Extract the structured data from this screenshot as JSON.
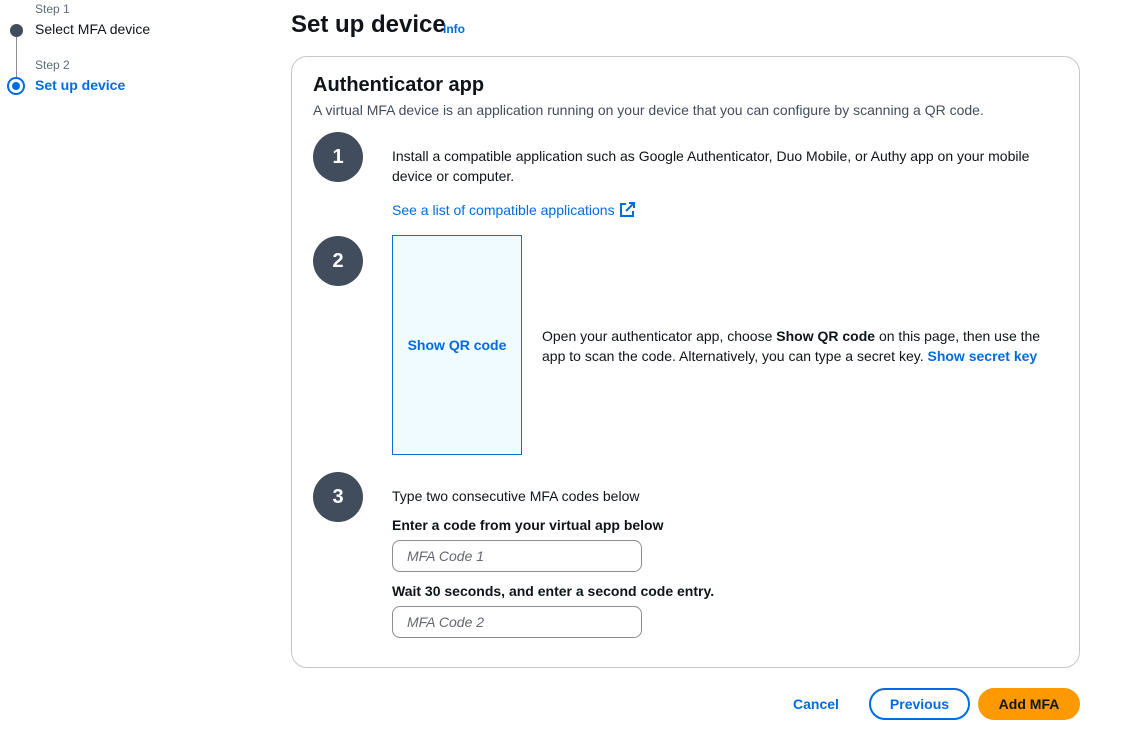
{
  "stepper": {
    "steps": [
      {
        "small": "Step 1",
        "name": "Select MFA device",
        "state": "completed"
      },
      {
        "small": "Step 2",
        "name": "Set up device",
        "state": "active"
      }
    ]
  },
  "header": {
    "title": "Set up device",
    "info": "Info"
  },
  "card": {
    "title": "Authenticator app",
    "description": "A virtual MFA device is an application running on your device that you can configure by scanning a QR code.",
    "step1": {
      "number": "1",
      "text": "Install a compatible application such as Google Authenticator, Duo Mobile, or Authy app on your mobile device or computer.",
      "link": "See a list of compatible applications"
    },
    "step2": {
      "number": "2",
      "qr_button": "Show QR code",
      "text_before": "Open your authenticator app, choose ",
      "text_bold": "Show QR code",
      "text_after": " on this page, then use the app to scan the code. Alternatively, you can type a secret key. ",
      "secret_link": "Show secret key"
    },
    "step3": {
      "number": "3",
      "intro": "Type two consecutive MFA codes below",
      "code1_label": "Enter a code from your virtual app below",
      "code1_placeholder": "MFA Code 1",
      "code2_label": "Wait 30 seconds, and enter a second code entry.",
      "code2_placeholder": "MFA Code 2"
    }
  },
  "footer": {
    "cancel": "Cancel",
    "previous": "Previous",
    "add": "Add MFA"
  },
  "colors": {
    "link": "#006ce0",
    "primary_button": "#ff9900",
    "step_circle": "#414d5c"
  }
}
